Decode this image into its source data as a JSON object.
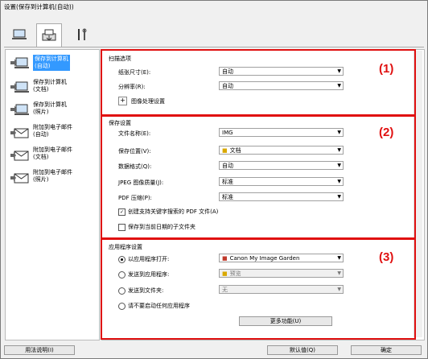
{
  "window": {
    "title": "设置(保存到计算机(自动))"
  },
  "toolbar": {
    "tabs": [
      {
        "icon": "scan-from-computer-icon"
      },
      {
        "icon": "scan-from-panel-icon"
      },
      {
        "icon": "general-settings-icon"
      }
    ],
    "selected": 1
  },
  "sidebar": {
    "items": [
      {
        "label": "保存到计算机\n(自动)",
        "icon": "save-computer-icon",
        "selected": true
      },
      {
        "label": "保存到计算机\n(文档)",
        "icon": "save-computer-icon"
      },
      {
        "label": "保存到计算机\n(照片)",
        "icon": "save-computer-icon"
      },
      {
        "label": "附加到电子邮件\n(自动)",
        "icon": "email-icon"
      },
      {
        "label": "附加到电子邮件\n(文档)",
        "icon": "email-icon"
      },
      {
        "label": "附加到电子邮件\n(照片)",
        "icon": "email-icon"
      }
    ]
  },
  "scan_options": {
    "title": "扫描选项",
    "paper_size_label": "纸张尺寸(E):",
    "paper_size_value": "自动",
    "resolution_label": "分辨率(R):",
    "resolution_value": "自动",
    "image_processing_label": "图像处理设置",
    "marker": "(1)"
  },
  "save_settings": {
    "title": "保存设置",
    "file_name_label": "文件名称(E):",
    "file_name_value": "IMG",
    "save_in_label": "保存位置(V):",
    "save_in_value": "文档",
    "data_format_label": "数据格式(Q):",
    "data_format_value": "自动",
    "jpeg_quality_label": "JPEG 图像质量(J):",
    "jpeg_quality_value": "标准",
    "pdf_compression_label": "PDF 压缩(P):",
    "pdf_compression_value": "标准",
    "keyword_pdf_label": "创建支持关键字搜索的 PDF 文件(A)",
    "keyword_pdf_checked": true,
    "subfolder_label": "保存到当前日期的子文件夹",
    "subfolder_checked": false,
    "marker": "(2)"
  },
  "app_settings": {
    "title": "应用程序设置",
    "open_with_label": "以应用程序打开:",
    "open_with_value": "Canon My Image Garden",
    "send_to_app_label": "发送到应用程序:",
    "send_to_app_value": "预览",
    "send_to_folder_label": "发送到文件夹:",
    "send_to_folder_value": "无",
    "do_not_start_label": "请不要启动任何应用程序",
    "more_functions_label": "更多功能(U)",
    "selected": 0,
    "marker": "(3)"
  },
  "footer": {
    "instructions_label": "用法说明(I)",
    "defaults_label": "默认值(Q)",
    "ok_label": "确定"
  }
}
